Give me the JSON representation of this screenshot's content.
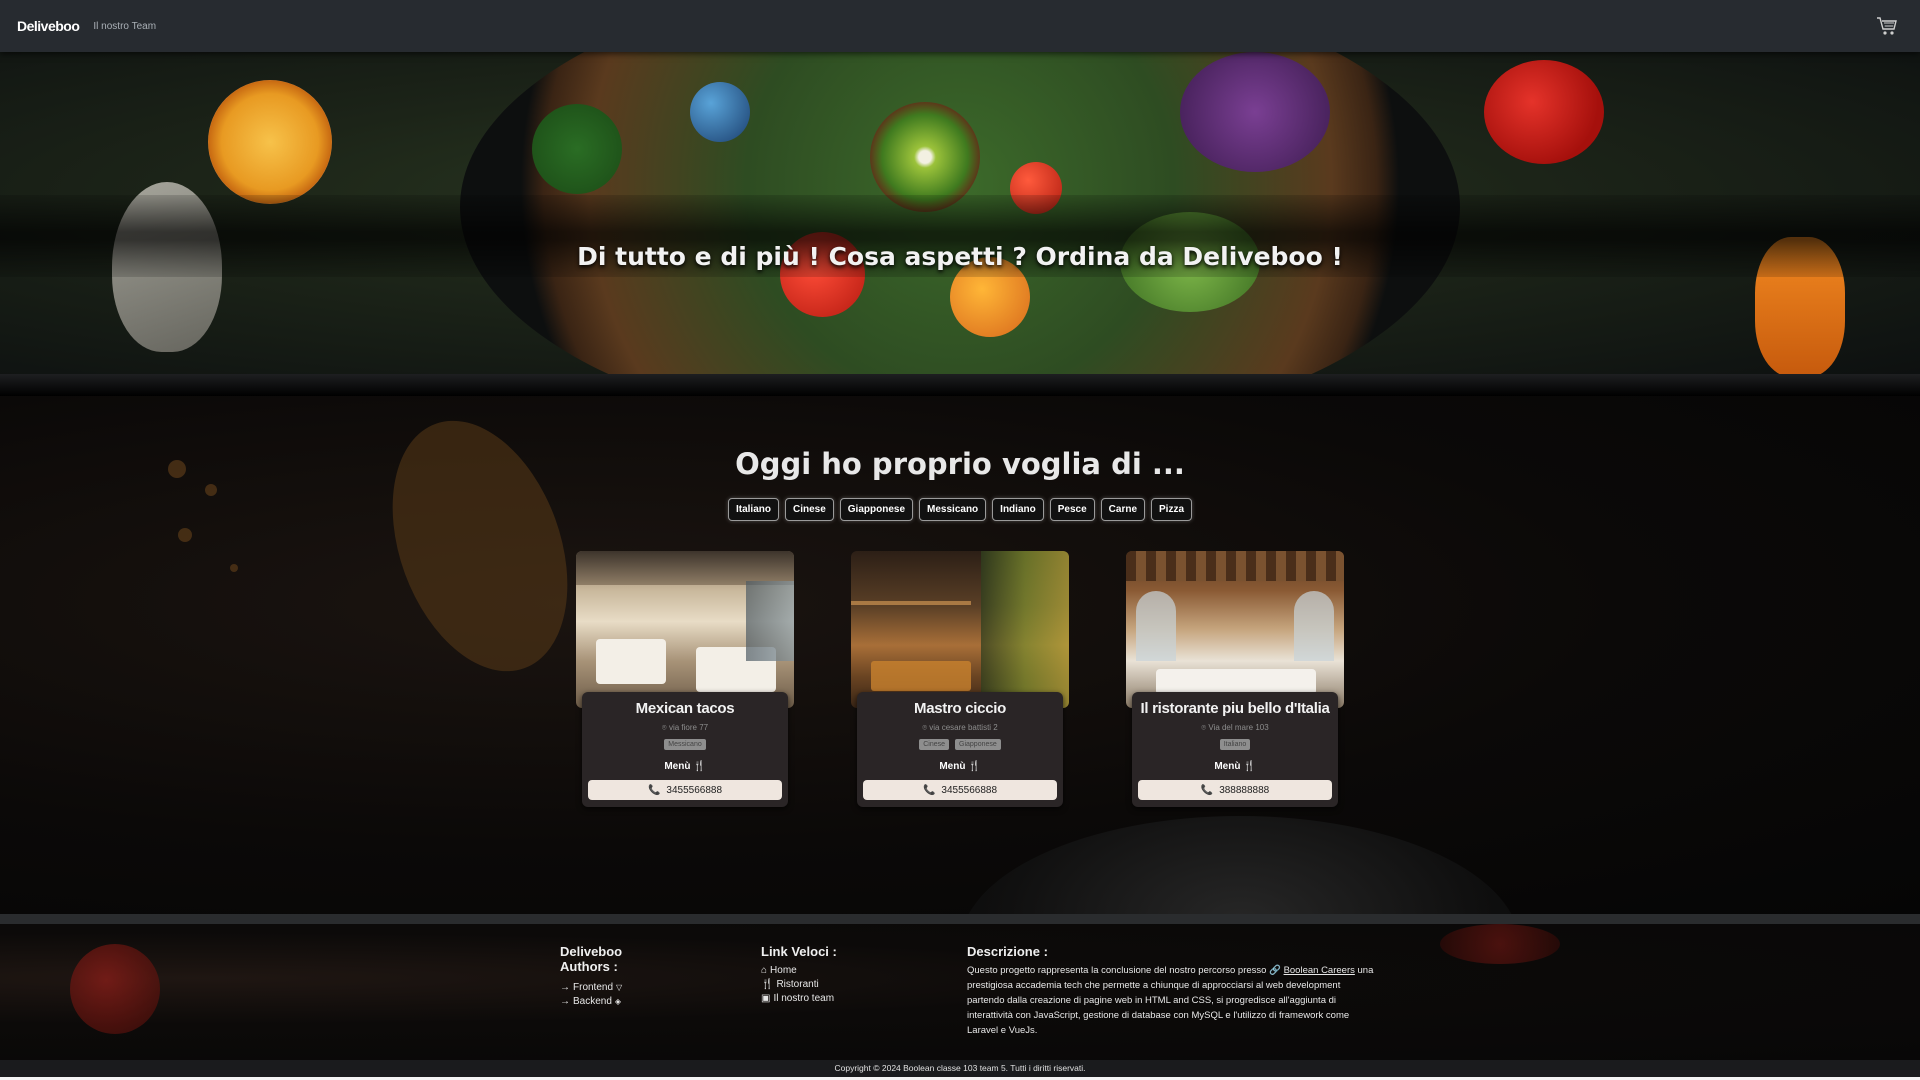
{
  "navbar": {
    "brand": "Deliveboo",
    "team_link": "Il nostro Team",
    "cart_icon": "cart-icon"
  },
  "hero": {
    "title": "Di tutto e di più ! Cosa aspetti ? Ordina da Deliveboo !"
  },
  "main": {
    "title": "Oggi ho proprio voglia di ...",
    "filters": [
      "Italiano",
      "Cinese",
      "Giapponese",
      "Messicano",
      "Indiano",
      "Pesce",
      "Carne",
      "Pizza"
    ]
  },
  "restaurants": [
    {
      "name": "Mexican tacos",
      "address": "via fiore 77",
      "tags": [
        "Messicano"
      ],
      "menu_label": "Menù",
      "phone": "3455566888"
    },
    {
      "name": "Mastro ciccio",
      "address": "via cesare battisti 2",
      "tags": [
        "Cinese",
        "Giapponese"
      ],
      "menu_label": "Menù",
      "phone": "3455566888"
    },
    {
      "name": "Il ristorante piu bello d'Italia",
      "address": "Via del mare 103",
      "tags": [
        "Italiano"
      ],
      "menu_label": "Menù",
      "phone": "388888888"
    }
  ],
  "footer": {
    "col1": {
      "title_line1": "Deliveboo",
      "title_line2": "Authors :",
      "links": [
        "Frontend",
        "Backend"
      ]
    },
    "col2": {
      "title": "Link Veloci :",
      "links": [
        "Home",
        "Ristoranti",
        "Il nostro team"
      ]
    },
    "col3": {
      "title": "Descrizione :",
      "text_before": "Questo progetto rappresenta la conclusione del nostro percorso presso",
      "link": "Boolean Careers",
      "text_after": "una prestigiosa accademia tech che permette a chiunque di approcciarsi al web development partendo dalla creazione di pagine web in HTML and CSS, si progredisce all'aggiunta di interattività con JavaScript, gestione di database con MySQL e l'utilizzo di framework come Laravel e VueJs."
    },
    "copyright": "Copyright © 2024 Boolean classe 103 team 5. Tutti i diritti riservati."
  }
}
